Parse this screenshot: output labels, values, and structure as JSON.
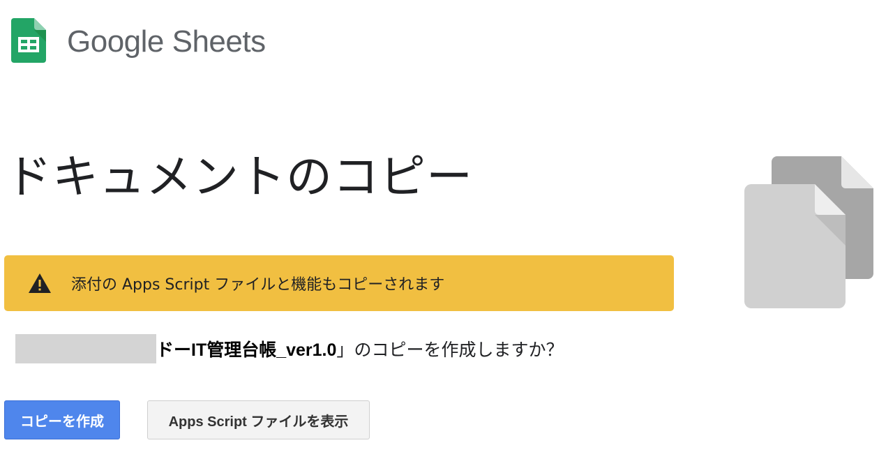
{
  "header": {
    "brand": "Google Sheets",
    "icon": "google-sheets-icon"
  },
  "page": {
    "title": "ドキュメントのコピー"
  },
  "warning": {
    "icon": "warning-icon",
    "text": "添付の Apps Script ファイルと機能もコピーされます"
  },
  "question": {
    "document_name": "ドーIT管理台帳_ver1.0",
    "quote_close": "」",
    "suffix": "のコピーを作成しますか？"
  },
  "buttons": {
    "make_copy": "コピーを作成",
    "view_apps_script": "Apps Script ファイルを表示"
  },
  "illustration": {
    "icon": "copy-documents-icon"
  },
  "colors": {
    "warning_bg": "#f1bf41",
    "primary_button": "#4f86ec",
    "sheets_green": "#0f9d58"
  }
}
